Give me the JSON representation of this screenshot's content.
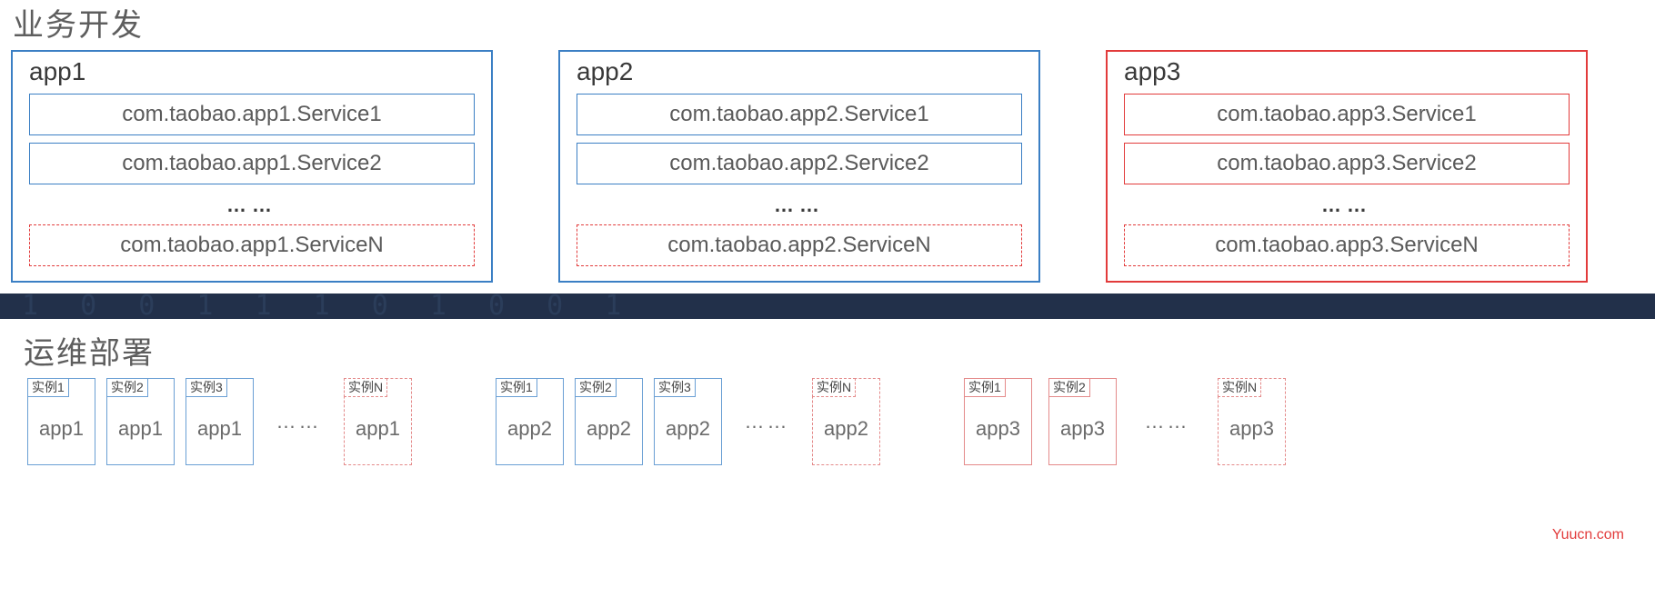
{
  "colors": {
    "blue": "#3b7fc4",
    "red": "#e23b3b"
  },
  "sections": {
    "top_title": "业务开发",
    "bottom_title": "运维部署"
  },
  "apps": [
    {
      "name": "app1",
      "color": "blue",
      "services": [
        {
          "text": "com.taobao.app1.Service1",
          "style": "solid",
          "color": "blue"
        },
        {
          "text": "com.taobao.app1.Service2",
          "style": "solid",
          "color": "blue"
        }
      ],
      "dots": "……",
      "serviceN": {
        "text": "com.taobao.app1.ServiceN",
        "style": "dashed",
        "color": "red"
      }
    },
    {
      "name": "app2",
      "color": "blue",
      "services": [
        {
          "text": "com.taobao.app2.Service1",
          "style": "solid",
          "color": "blue"
        },
        {
          "text": "com.taobao.app2.Service2",
          "style": "solid",
          "color": "blue"
        }
      ],
      "dots": "……",
      "serviceN": {
        "text": "com.taobao.app2.ServiceN",
        "style": "dashed",
        "color": "red"
      }
    },
    {
      "name": "app3",
      "color": "red",
      "services": [
        {
          "text": "com.taobao.app3.Service1",
          "style": "solid",
          "color": "red"
        },
        {
          "text": "com.taobao.app3.Service2",
          "style": "solid",
          "color": "red"
        }
      ],
      "dots": "……",
      "serviceN": {
        "text": "com.taobao.app3.ServiceN",
        "style": "dashed",
        "color": "red"
      }
    }
  ],
  "instances": [
    {
      "app": "app1",
      "color": "blue",
      "items": [
        {
          "label": "实例1",
          "style": "solid",
          "color": "blue"
        },
        {
          "label": "实例2",
          "style": "solid",
          "color": "blue"
        },
        {
          "label": "实例3",
          "style": "solid",
          "color": "blue"
        },
        {
          "ellipsis": "……"
        },
        {
          "label": "实例N",
          "style": "dashed",
          "color": "red"
        }
      ]
    },
    {
      "app": "app2",
      "color": "blue",
      "items": [
        {
          "label": "实例1",
          "style": "solid",
          "color": "blue"
        },
        {
          "label": "实例2",
          "style": "solid",
          "color": "blue"
        },
        {
          "label": "实例3",
          "style": "solid",
          "color": "blue"
        },
        {
          "ellipsis": "……"
        },
        {
          "label": "实例N",
          "style": "dashed",
          "color": "red"
        }
      ]
    },
    {
      "app": "app3",
      "color": "red",
      "items": [
        {
          "label": "实例1",
          "style": "solid",
          "color": "red"
        },
        {
          "label": "实例2",
          "style": "solid",
          "color": "red"
        },
        {
          "ellipsis": "……"
        },
        {
          "label": "实例N",
          "style": "dashed",
          "color": "red"
        }
      ]
    }
  ],
  "watermark": "Yuucn.com"
}
